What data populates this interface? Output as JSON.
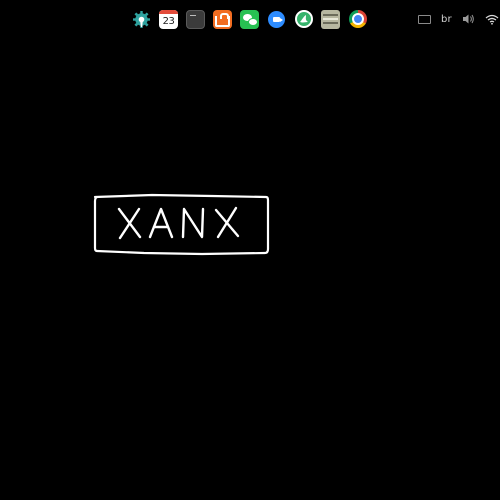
{
  "topbar": {
    "dock": {
      "apps": [
        {
          "icon": "settings-icon"
        },
        {
          "icon": "calendar-icon",
          "label": "23"
        },
        {
          "icon": "terminal-icon"
        },
        {
          "icon": "app-store-icon"
        },
        {
          "icon": "wechat-icon"
        },
        {
          "icon": "zoom-icon"
        },
        {
          "icon": "bird-app-icon"
        },
        {
          "icon": "files-icon"
        },
        {
          "icon": "chrome-icon"
        }
      ]
    },
    "tray": {
      "keyboard_icon": "keyboard-icon",
      "input_language": "br",
      "volume_icon": "volume-icon",
      "wifi_icon": "wifi-icon"
    }
  },
  "canvas": {
    "handwritten_text": "XANX",
    "stroke_color": "#ffffff"
  },
  "colors": {
    "background": "#000000"
  }
}
